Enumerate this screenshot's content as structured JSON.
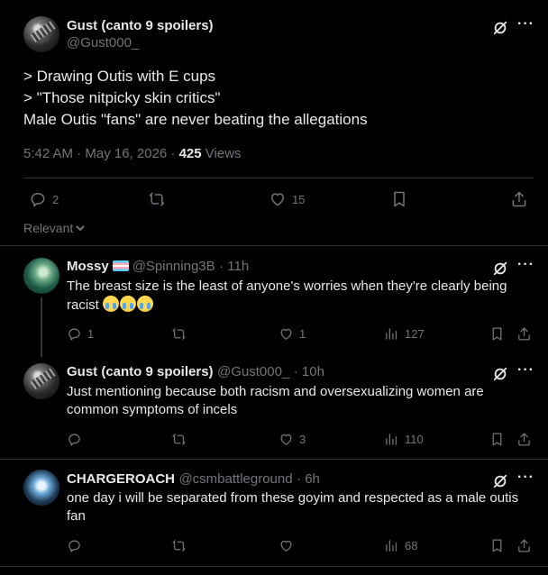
{
  "main_tweet": {
    "author_name": "Gust (canto 9 spoilers)",
    "author_handle": "@Gust000_",
    "lines": [
      "> Drawing Outis with E cups",
      "> \"Those nitpicky skin critics\"",
      "Male Outis \"fans\" are never beating the allegations"
    ],
    "timestamp": "5:42 AM · May 16, 2026 · ",
    "views_count": "425",
    "views_label": " Views",
    "actions": {
      "replies": "2",
      "retweets": "",
      "likes": "15"
    },
    "icons": [
      "grok-icon",
      "more-icon",
      "reply-icon",
      "retweet-icon",
      "like-icon",
      "bookmark-icon",
      "share-icon"
    ]
  },
  "sort": {
    "label": "Relevant"
  },
  "replies": [
    {
      "name": "Mossy",
      "handle": "@Spinning3B",
      "time": "· 11h",
      "text": "The breast size is the least of anyone's worries when they're clearly being racist",
      "emoji_count": 3,
      "reply_count": "1",
      "retweet_count": "",
      "like_count": "1",
      "view_count": "127"
    },
    {
      "name": "Gust (canto 9 spoilers)",
      "handle": "@Gust000_",
      "time": "· 10h",
      "text": "Just mentioning because both racism and oversexualizing women are common symptoms of incels",
      "reply_count": "",
      "retweet_count": "",
      "like_count": "3",
      "view_count": "110"
    },
    {
      "name": "CHARGEROACH",
      "handle": "@csmbattleground",
      "time": "· 6h",
      "text": "one day i will be separated from these goyim and respected as a male outis fan",
      "reply_count": "",
      "retweet_count": "",
      "like_count": "",
      "view_count": "68"
    }
  ],
  "colors": {
    "background": "#000000",
    "text": "#e7e9ea",
    "muted": "#71767b",
    "divider": "#2f3336"
  }
}
